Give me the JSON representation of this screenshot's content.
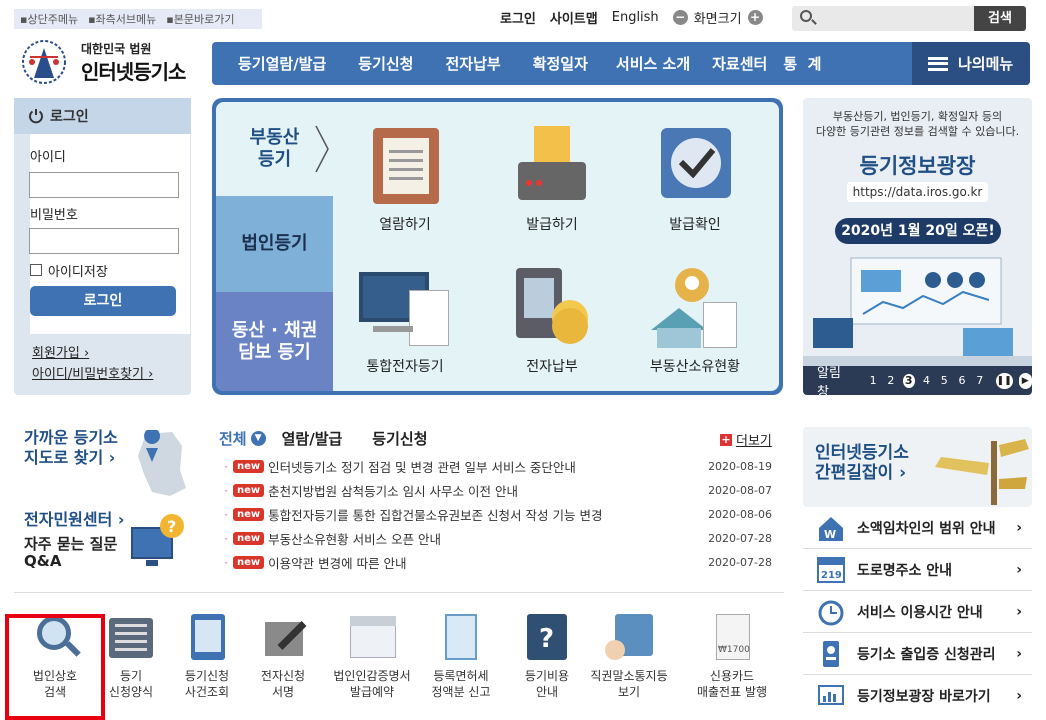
{
  "skip_links": [
    "상단주메뉴",
    "좌측서브메뉴",
    "본문바로가기"
  ],
  "utils": {
    "login": "로그인",
    "sitemap": "사이트맵",
    "english": "English",
    "zoom": "화면크기",
    "minus": "−",
    "plus": "+"
  },
  "search": {
    "button": "검색",
    "placeholder": ""
  },
  "logo": {
    "sub": "대한민국 법원",
    "main": "인터넷등기소"
  },
  "gnb": [
    "등기열람/발급",
    "등기신청",
    "전자납부",
    "확정일자",
    "서비스 소개",
    "자료센터",
    "통  계"
  ],
  "mymenu": "나의메뉴",
  "login": {
    "title": "로그인",
    "id_label": "아이디",
    "pw_label": "비밀번호",
    "save_id": "아이디저장",
    "button": "로그인",
    "join": "회원가입 ›",
    "find": "아이디/비밀번호찾기 ›"
  },
  "svc": {
    "tabs": [
      "부동산\n등기",
      "법인등기",
      "동산 · 채권\n담보 등기"
    ],
    "items": [
      "열람하기",
      "발급하기",
      "발급확인",
      "통합전자등기",
      "전자납부",
      "부동산소유현황"
    ]
  },
  "banner": {
    "desc1": "부동산등기, 법인등기, 확정일자 등의",
    "desc2": "다양한 등기관련 정보를 검색할 수 있습니다.",
    "title": "등기정보광장",
    "url": "https://data.iros.go.kr",
    "open": "2020년 1월 20일 오픈!",
    "bar_label": "알림창",
    "pages": [
      "1",
      "2",
      "3",
      "4",
      "5",
      "6",
      "7"
    ],
    "current_page": "3"
  },
  "lower_left": {
    "near": "가까운 등기소\n지도로 찾기 ›",
    "center": "전자민원센터 ›",
    "faq": "자주 묻는 질문\nQ&A"
  },
  "notices": {
    "tabs": [
      "전체",
      "열람/발급",
      "등기신청"
    ],
    "more": "더보기",
    "new_label": "new",
    "items": [
      {
        "title": "인터넷등기소 정기 점검 및 변경 관련 일부 서비스 중단안내",
        "date": "2020-08-19"
      },
      {
        "title": "춘천지방법원 삼척등기소 임시 사무소 이전 안내",
        "date": "2020-08-07"
      },
      {
        "title": "통합전자등기를 통한 집합건물소유권보존 신청서 작성 기능 변경",
        "date": "2020-08-06"
      },
      {
        "title": "부동산소유현황 서비스 오픈 안내",
        "date": "2020-07-28"
      },
      {
        "title": "이용약관 변경에 따른 안내",
        "date": "2020-07-28"
      }
    ]
  },
  "quick": {
    "banner_title": "인터넷등기소\n간편길잡이 ›",
    "rows": [
      "소액임차인의 범위 안내",
      "도로명주소 안내",
      "서비스 이용시간 안내",
      "등기소 출입증 신청관리",
      "등기정보광장 바로가기"
    ],
    "road_icon": "219"
  },
  "bottom": [
    "법인상호\n검색",
    "등기\n신청양식",
    "등기신청\n사건조회",
    "전자신청\n서명",
    "법인인감증명서\n발급예약",
    "등록면허세\n정액분 신고",
    "등기비용\n안내",
    "직권말소통지등\n보기",
    "신용카드\n매출전표 발행"
  ],
  "bottom_card": "₩1700",
  "colors": {
    "primary": "#3e72b3",
    "highlight": "#e60012",
    "new": "#d9362b"
  }
}
